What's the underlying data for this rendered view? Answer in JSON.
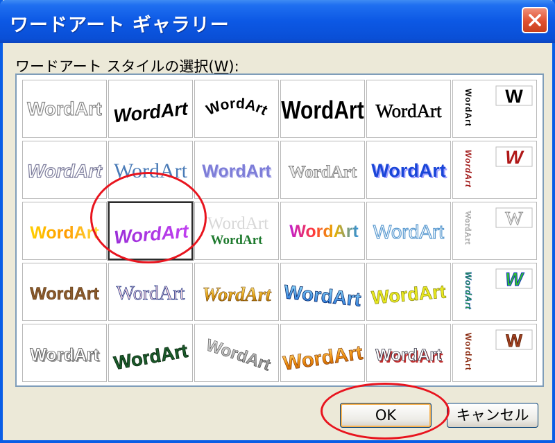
{
  "title": "ワードアート ギャラリー",
  "prompt": {
    "text": "ワードアート スタイルの選択(",
    "accel": "W",
    "tail": "):"
  },
  "gallery": {
    "word": "WordArt",
    "vertical_word": "WordArt",
    "side_letter": "W",
    "selected_row": 3,
    "selected_col": 2
  },
  "buttons": {
    "ok": "OK",
    "cancel": "キャンセル"
  },
  "colors": {
    "titlebar": "#0a5ee6",
    "close": "#e0502f",
    "highlight_ring": "#e8141e",
    "focus": "#f8b24f"
  }
}
